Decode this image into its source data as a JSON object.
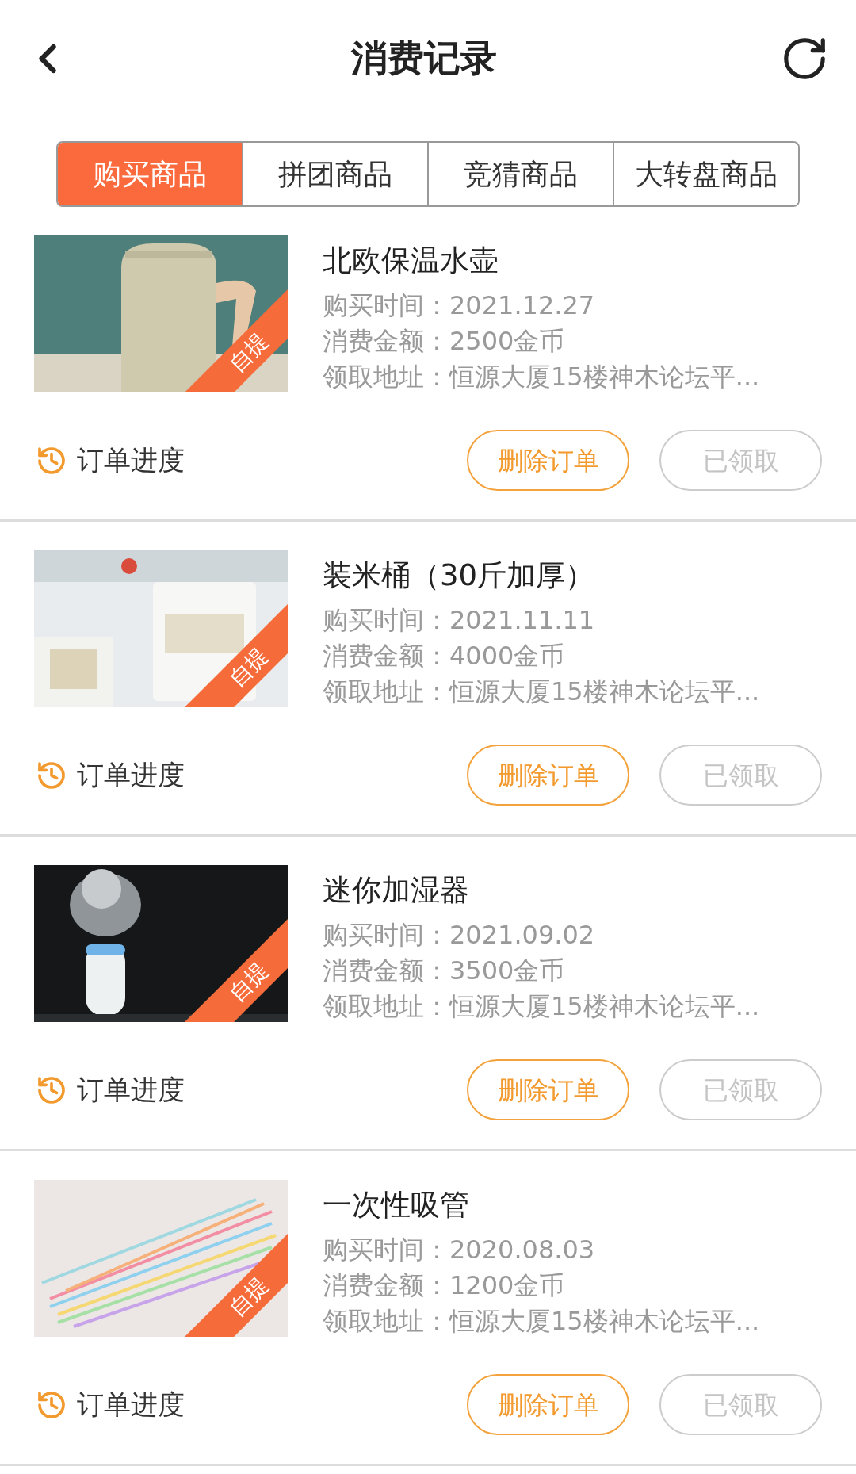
{
  "header": {
    "title": "消费记录"
  },
  "tabs": [
    {
      "label": "购买商品",
      "selected": true
    },
    {
      "label": "拼团商品",
      "selected": false
    },
    {
      "label": "竞猜商品",
      "selected": false
    },
    {
      "label": "大转盘商品",
      "selected": false
    }
  ],
  "orders": [
    {
      "name": "北欧保温水壶",
      "ribbon": "自提",
      "time": "购买时间：2021.12.27",
      "amount": "消费金额：2500金币",
      "address": "领取地址：恒源大厦15楼神木论坛平...",
      "progress": "订单进度",
      "delete_button": "删除订单",
      "status_button": {
        "label": "已领取",
        "disabled": true
      }
    },
    {
      "name": "装米桶（30斤加厚）",
      "ribbon": "自提",
      "time": "购买时间：2021.11.11",
      "amount": "消费金额：4000金币",
      "address": "领取地址：恒源大厦15楼神木论坛平...",
      "progress": "订单进度",
      "delete_button": "删除订单",
      "status_button": {
        "label": "已领取",
        "disabled": true
      }
    },
    {
      "name": "迷你加湿器",
      "ribbon": "自提",
      "time": "购买时间：2021.09.02",
      "amount": "消费金额：3500金币",
      "address": "领取地址：恒源大厦15楼神木论坛平...",
      "progress": "订单进度",
      "delete_button": "删除订单",
      "status_button": {
        "label": "已领取",
        "disabled": true
      }
    },
    {
      "name": "一次性吸管",
      "ribbon": "自提",
      "time": "购买时间：2020.08.03",
      "amount": "消费金额：1200金币",
      "address": "领取地址：恒源大厦15楼神木论坛平...",
      "progress": "订单进度",
      "delete_button": "删除订单",
      "status_button": {
        "label": "已领取",
        "disabled": true
      }
    }
  ]
}
